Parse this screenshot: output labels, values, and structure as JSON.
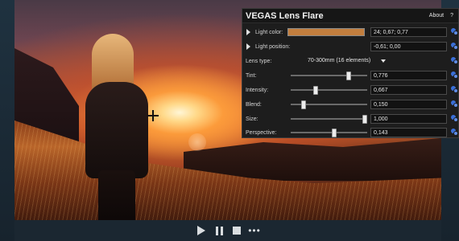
{
  "transport": {
    "play_icon": "play-icon",
    "pause_icon": "pause-icon",
    "stop_icon": "stop-icon",
    "more": "•••"
  },
  "panel": {
    "title": "VEGAS Lens Flare",
    "about": "About",
    "help": "?",
    "light_color": {
      "label": "Light color:",
      "value": "24; 0,67; 0,77",
      "swatch": "#c27e3e"
    },
    "light_position": {
      "label": "Light position:",
      "value": "-0,61; 0,00"
    },
    "lens_type": {
      "label": "Lens type:",
      "value": "70-300mm (16 elements)"
    },
    "sliders": [
      {
        "label": "Tint:",
        "value": "0,776",
        "fraction": 0.776
      },
      {
        "label": "Intensity:",
        "value": "0,667",
        "fraction": 0.31
      },
      {
        "label": "Blend:",
        "value": "0,150",
        "fraction": 0.15
      },
      {
        "label": "Size:",
        "value": "1,000",
        "fraction": 1.0
      },
      {
        "label": "Perspective:",
        "value": "0,143",
        "fraction": 0.571
      }
    ]
  }
}
